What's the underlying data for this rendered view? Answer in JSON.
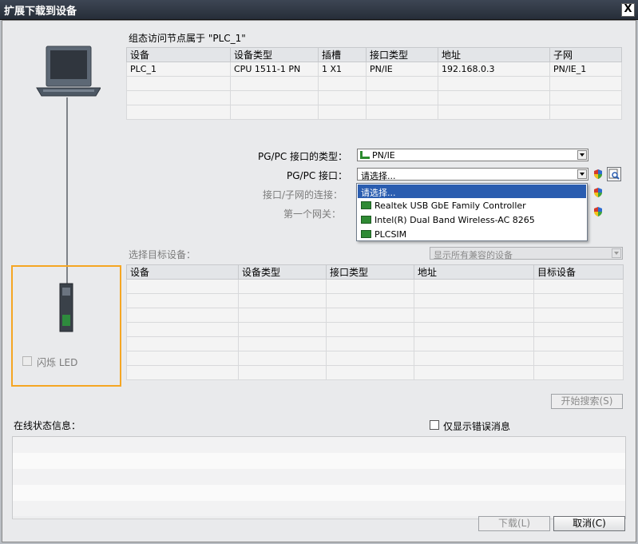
{
  "window": {
    "title": "扩展下载到设备",
    "close_glyph": "X"
  },
  "config_section": {
    "heading": "组态访问节点属于 \"PLC_1\"",
    "columns": [
      "设备",
      "设备类型",
      "插槽",
      "接口类型",
      "地址",
      "子网"
    ],
    "rows": [
      [
        "PLC_1",
        "CPU 1511-1 PN",
        "1 X1",
        "PN/IE",
        "192.168.0.3",
        "PN/IE_1"
      ]
    ]
  },
  "interface": {
    "type_label": "PG/PC 接口的类型：",
    "type_value": "PN/IE",
    "interface_label": "PG/PC 接口：",
    "interface_value": "请选择...",
    "connection_label": "接口/子网的连接：",
    "gateway_label": "第一个网关：",
    "dropdown_options": [
      "请选择...",
      "Realtek USB GbE Family Controller",
      "Intel(R) Dual Band Wireless-AC 8265",
      "PLCSIM"
    ]
  },
  "target_section": {
    "label": "选择目标设备：",
    "filter_value": "显示所有兼容的设备",
    "columns": [
      "设备",
      "设备类型",
      "接口类型",
      "地址",
      "目标设备"
    ],
    "empty_rows": 7
  },
  "flash_led_label": "闪烁 LED",
  "start_search_label": "开始搜索(S)",
  "status": {
    "label": "在线状态信息：",
    "errors_only_label": "仅显示错误消息"
  },
  "footer": {
    "download_label": "下载(L)",
    "cancel_label": "取消(C)"
  },
  "colors": {
    "highlight": "#f5a623",
    "selection": "#2a5db0"
  }
}
